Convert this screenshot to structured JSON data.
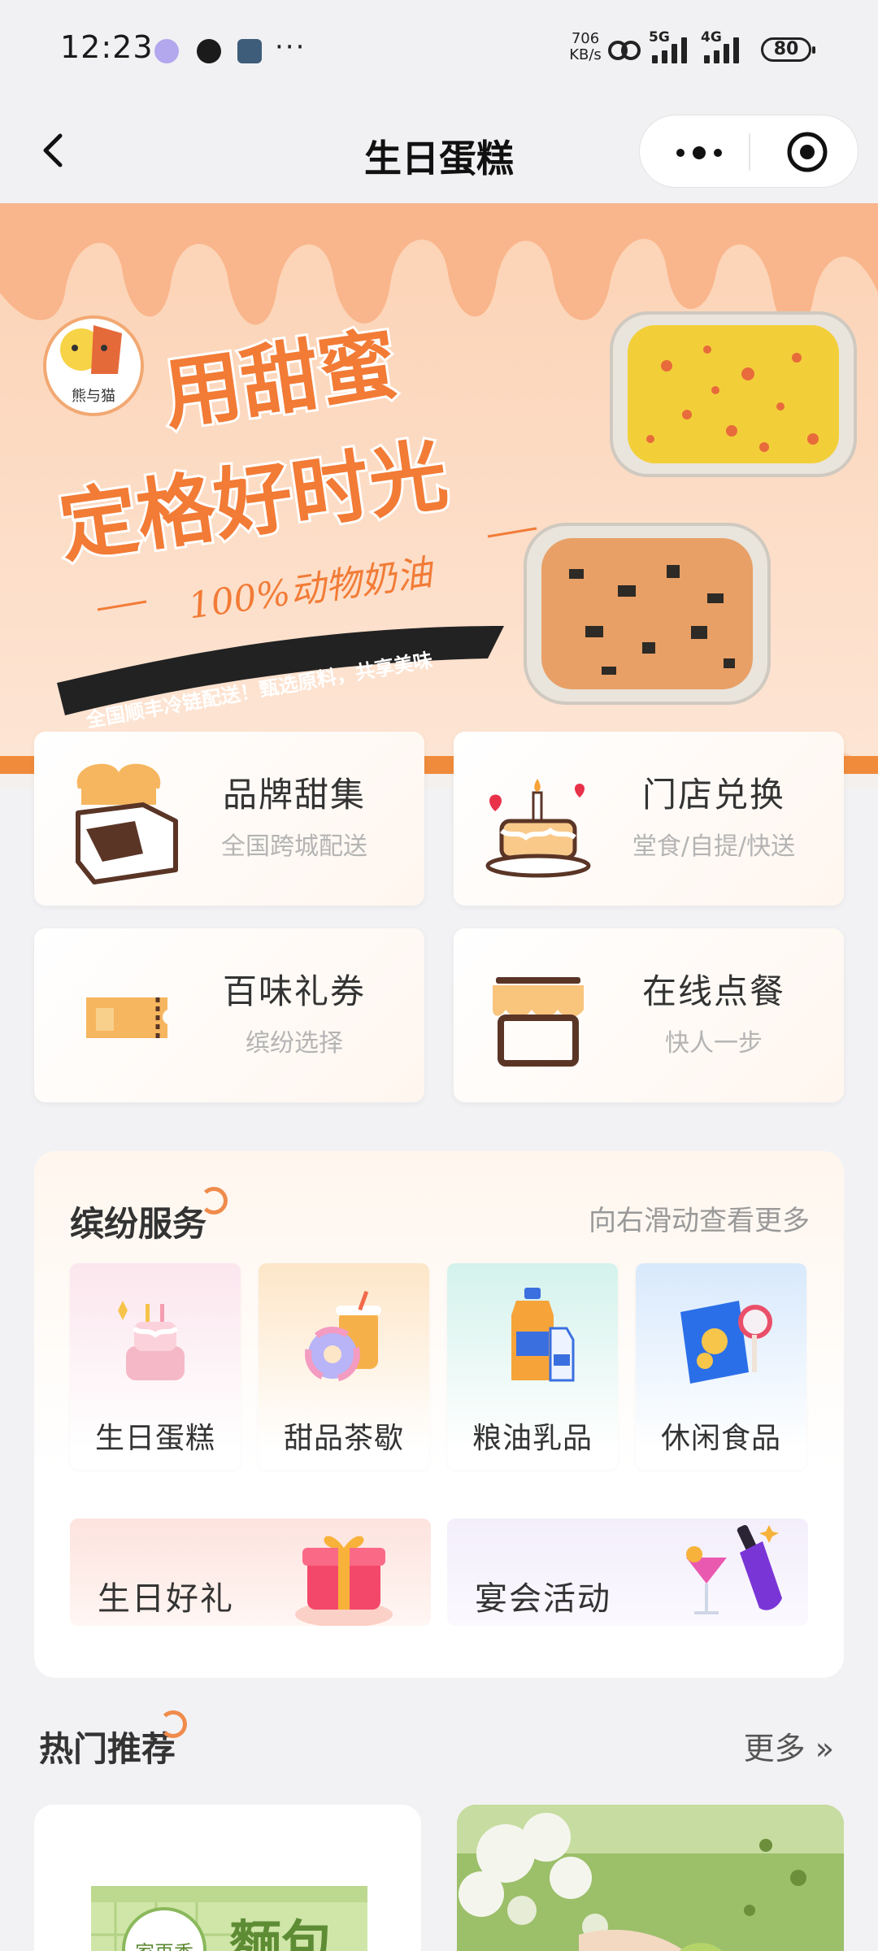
{
  "status_bar": {
    "time": "12:23",
    "dots": "···",
    "net_speed_value": "706",
    "net_speed_unit": "KB/s",
    "signal_1_label": "5G",
    "signal_2_label": "4G",
    "battery": "80"
  },
  "nav": {
    "title": "生日蛋糕"
  },
  "banner": {
    "logo_text": "熊与猫",
    "headline_1": "用甜蜜",
    "headline_2": "定格好时光",
    "tagline": "100%动物奶油",
    "ribbon": "全国顺丰冷链配送！甄选原料，共享美味"
  },
  "features": [
    {
      "title": "品牌甜集",
      "subtitle": "全国跨城配送",
      "icon": "chef-box-icon"
    },
    {
      "title": "门店兑换",
      "subtitle": "堂食/自提/快送",
      "icon": "birthday-cake-icon"
    },
    {
      "title": "百味礼券",
      "subtitle": "缤纷选择",
      "icon": "coupon-icon"
    },
    {
      "title": "在线点餐",
      "subtitle": "快人一步",
      "icon": "storefront-icon"
    }
  ],
  "services": {
    "title": "缤纷服务",
    "hint": "向右滑动查看更多",
    "items": [
      {
        "label": "生日蛋糕",
        "icon": "cake-icon"
      },
      {
        "label": "甜品茶歇",
        "icon": "donut-drink-icon"
      },
      {
        "label": "粮油乳品",
        "icon": "oil-milk-icon"
      },
      {
        "label": "休闲食品",
        "icon": "snack-icon"
      }
    ],
    "promos": [
      {
        "label": "生日好礼",
        "icon": "gift-box-icon"
      },
      {
        "label": "宴会活动",
        "icon": "cocktail-icon"
      }
    ]
  },
  "hot": {
    "title": "热门推荐",
    "more": "更多 »"
  },
  "products": [
    {
      "text": "麵包",
      "brand": "家再香"
    },
    {
      "text": ""
    }
  ]
}
